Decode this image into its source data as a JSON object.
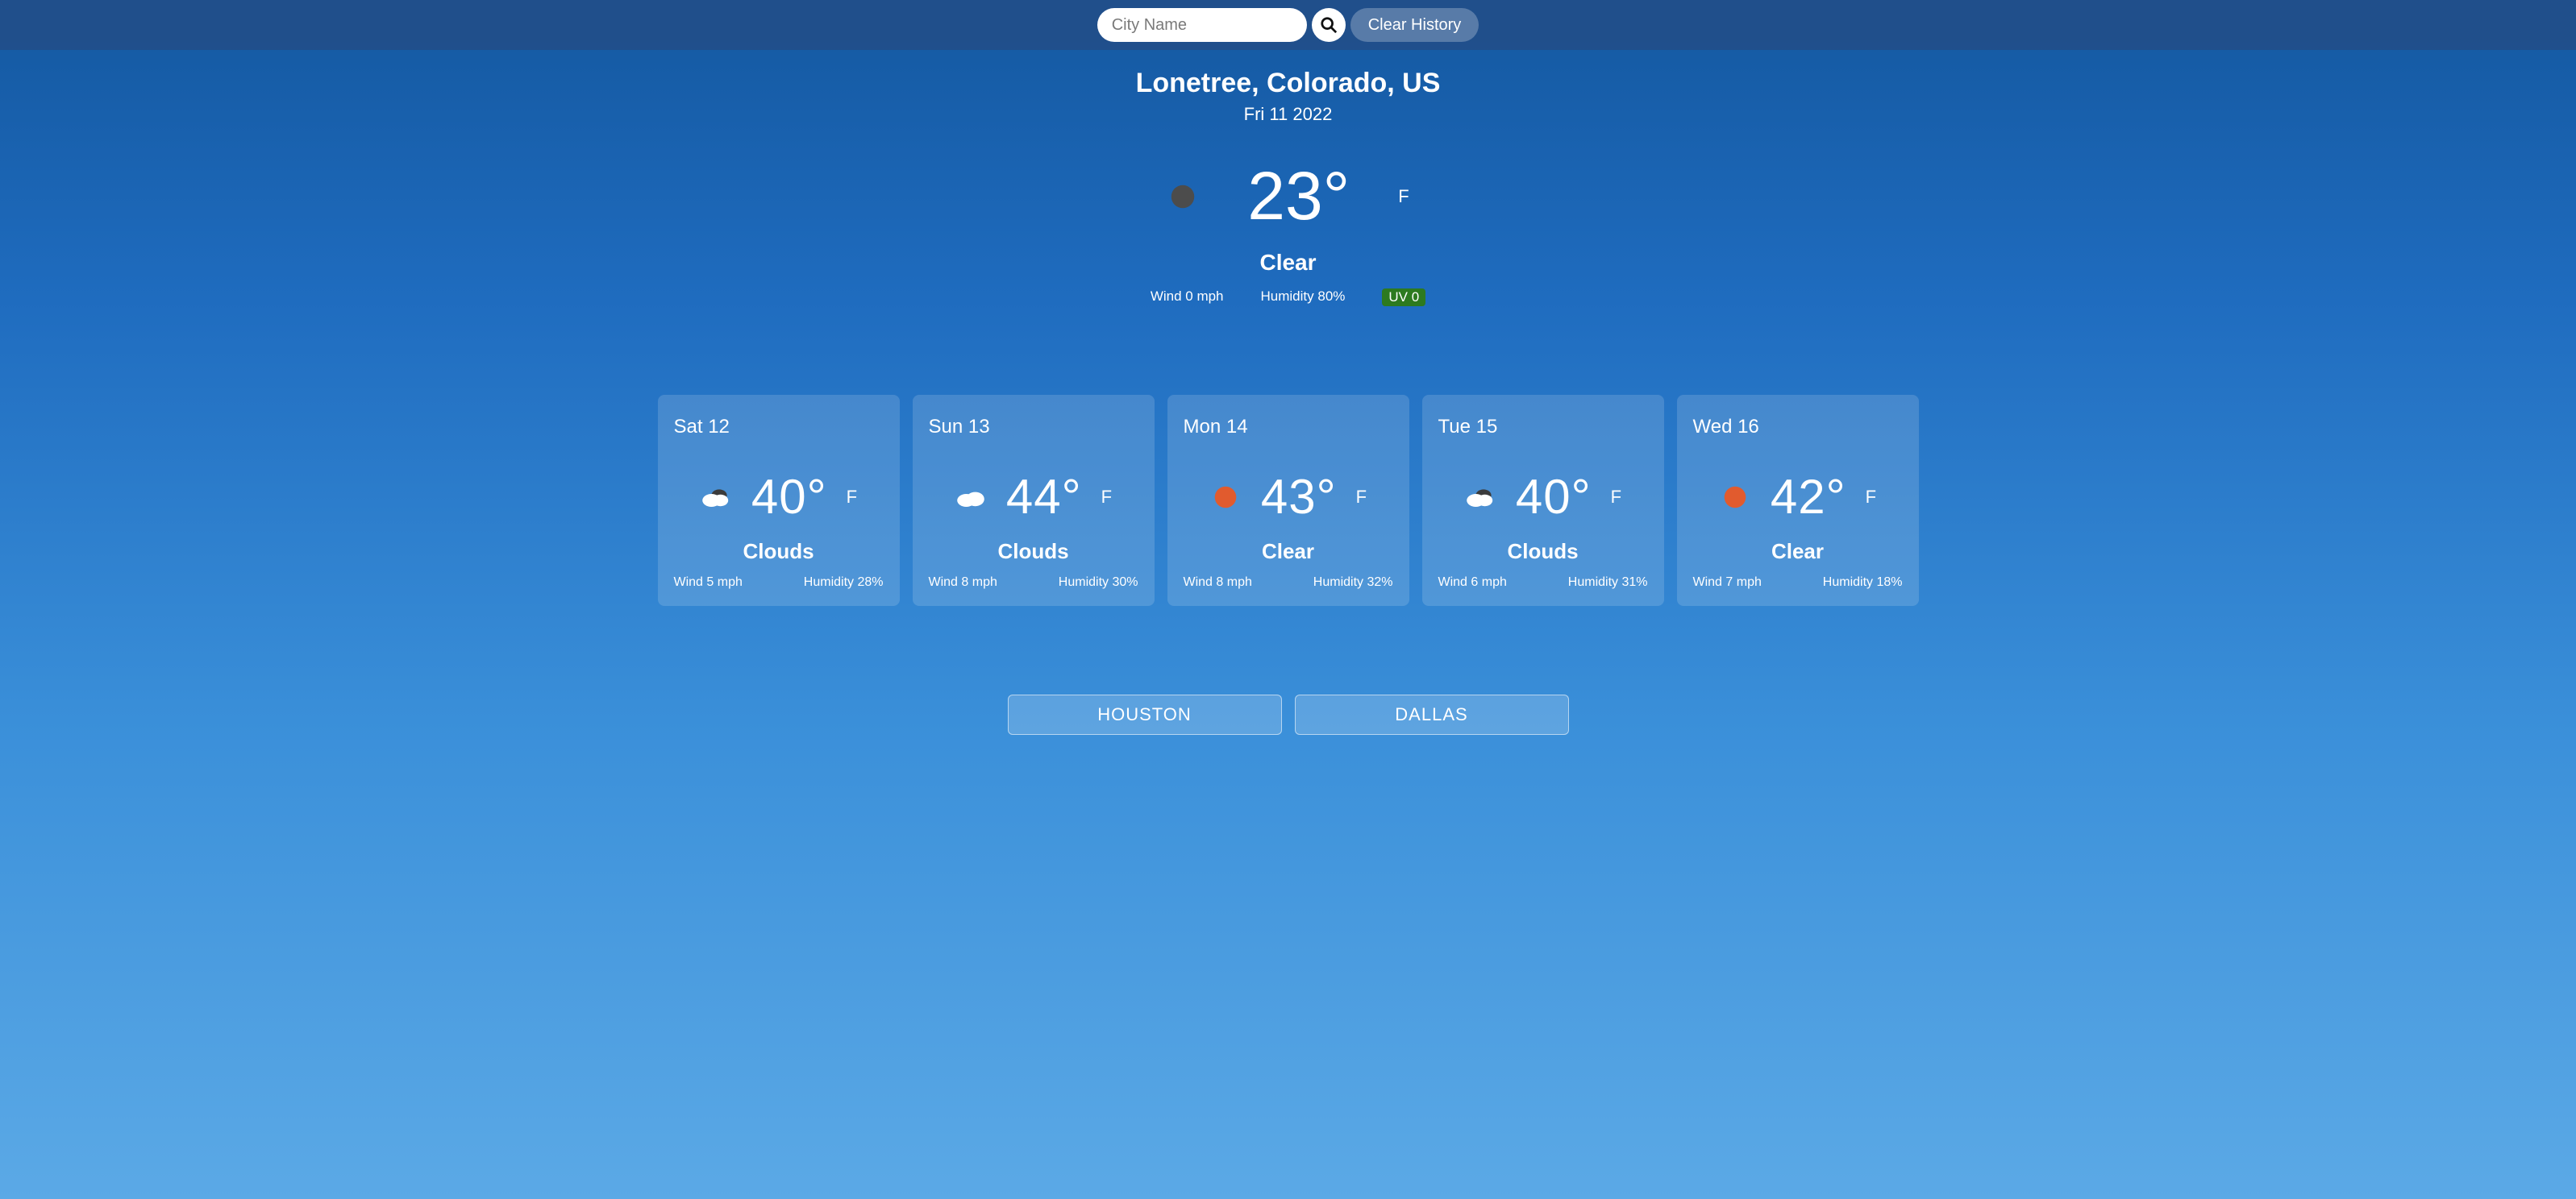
{
  "search": {
    "placeholder": "City Name",
    "clear_label": "Clear History"
  },
  "current": {
    "location": "Lonetree, Colorado, US",
    "date": "Fri 11 2022",
    "temp": "23°",
    "unit": "F",
    "icon": "moon",
    "description": "Clear",
    "wind": "Wind 0 mph",
    "humidity": "Humidity 80%",
    "uv": "UV 0"
  },
  "forecast": [
    {
      "date": "Sat 12",
      "icon": "cloud-dark",
      "temp": "40°",
      "unit": "F",
      "desc": "Clouds",
      "wind": "Wind 5 mph",
      "humidity": "Humidity 28%"
    },
    {
      "date": "Sun 13",
      "icon": "cloud",
      "temp": "44°",
      "unit": "F",
      "desc": "Clouds",
      "wind": "Wind 8 mph",
      "humidity": "Humidity 30%"
    },
    {
      "date": "Mon 14",
      "icon": "sun",
      "temp": "43°",
      "unit": "F",
      "desc": "Clear",
      "wind": "Wind 8 mph",
      "humidity": "Humidity 32%"
    },
    {
      "date": "Tue 15",
      "icon": "cloud-dark",
      "temp": "40°",
      "unit": "F",
      "desc": "Clouds",
      "wind": "Wind 6 mph",
      "humidity": "Humidity 31%"
    },
    {
      "date": "Wed 16",
      "icon": "sun",
      "temp": "42°",
      "unit": "F",
      "desc": "Clear",
      "wind": "Wind 7 mph",
      "humidity": "Humidity 18%"
    }
  ],
  "history": [
    {
      "label": "HOUSTON"
    },
    {
      "label": "DALLAS"
    }
  ]
}
